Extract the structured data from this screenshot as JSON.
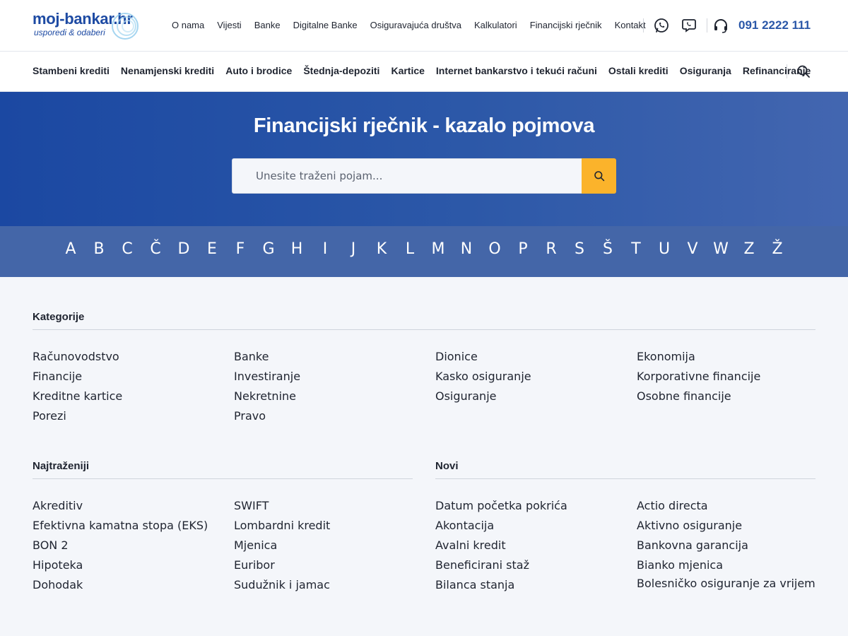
{
  "brand": {
    "name": "moj-bankar.hr",
    "tagline": "usporedi & odaberi"
  },
  "topnav": [
    "O nama",
    "Vijesti",
    "Banke",
    "Digitalne Banke",
    "Osiguravajuća društva",
    "Kalkulatori",
    "Financijski rječnik",
    "Kontakt"
  ],
  "contact": {
    "phone": "091 2222 111",
    "whatsapp_icon": "whatsapp-icon",
    "viber_icon": "viber-icon",
    "headset_icon": "headset-icon"
  },
  "mainnav": [
    "Stambeni krediti",
    "Nenamjenski krediti",
    "Auto i brodice",
    "Štednja-depoziti",
    "Kartice",
    "Internet bankarstvo i tekući računi",
    "Ostali krediti",
    "Osiguranja",
    "Refinanciranje"
  ],
  "hero": {
    "title": "Financijski rječnik - kazalo pojmova",
    "search_placeholder": "Unesite traženi pojam...",
    "search_value": ""
  },
  "alphabet": [
    "A",
    "B",
    "C",
    "Č",
    "D",
    "E",
    "F",
    "G",
    "H",
    "I",
    "J",
    "K",
    "L",
    "M",
    "N",
    "O",
    "P",
    "R",
    "S",
    "Š",
    "T",
    "U",
    "V",
    "W",
    "Z",
    "Ž"
  ],
  "categories": {
    "title": "Kategorije",
    "items": [
      "Računovodstvo",
      "Banke",
      "Dionice",
      "Ekonomija",
      "Financije",
      "Investiranje",
      "Kasko osiguranje",
      "Korporativne financije",
      "Kreditne kartice",
      "Nekretnine",
      "Osiguranje",
      "Osobne financije",
      "Porezi",
      "Pravo"
    ]
  },
  "popular": {
    "title": "Najtraženiji",
    "col1": [
      "Akreditiv",
      "Efektivna kamatna stopa (EKS)",
      "BON 2",
      "Hipoteka",
      "Dohodak"
    ],
    "col2": [
      "SWIFT",
      "Lombardni kredit",
      "Mjenica",
      "Euribor",
      "Sudužnik i jamac"
    ]
  },
  "newest": {
    "title": "Novi",
    "col1": [
      "Datum početka pokrića",
      "Akontacija",
      "Avalni kredit",
      "Beneficirani staž",
      "Bilanca stanja"
    ],
    "col2": [
      "Actio directa",
      "Aktivno osiguranje",
      "Bankovna garancija",
      "Bianko mjenica",
      "Bolesničko osiguranje za vrijeme"
    ]
  },
  "colors": {
    "brand_blue": "#1d4aa3",
    "hero_start": "#1b48a2",
    "hero_end": "#4366b0",
    "alpha_bar": "#4466a8",
    "accent_yellow": "#fbb32b",
    "page_bg": "#f4f6fa"
  }
}
